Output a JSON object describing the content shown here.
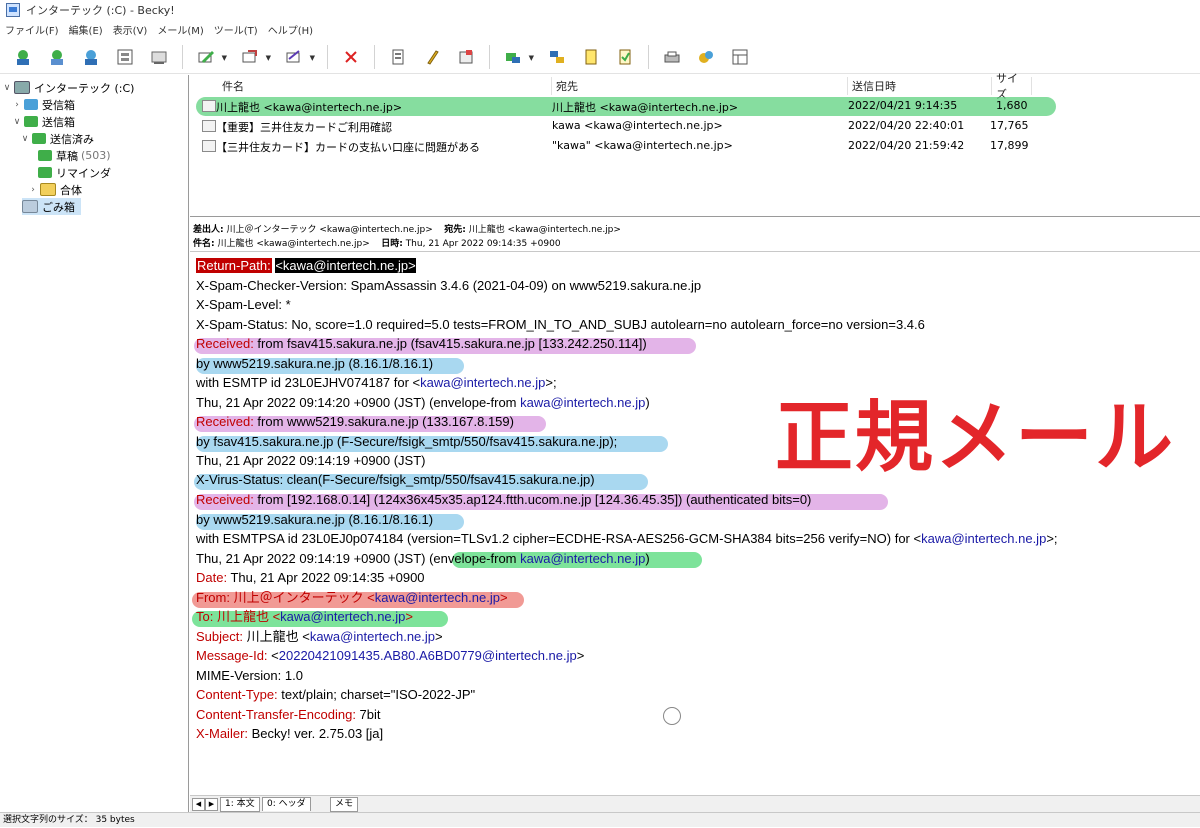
{
  "window": {
    "title": "インターテック (:C) - Becky!"
  },
  "menu": [
    "ファイル(F)",
    "編集(E)",
    "表示(V)",
    "メール(M)",
    "ツール(T)",
    "ヘルプ(H)"
  ],
  "toolbar": {
    "icons": [
      "receive-icon",
      "receive-all-icon",
      "send-icon",
      "folder-sync-icon",
      "address-book-icon",
      "compose-icon",
      "reply-icon",
      "forward-icon",
      "delete-icon",
      "filter-icon",
      "edit-icon",
      "flag-icon",
      "move-icon",
      "copy-icon",
      "memo-icon",
      "note-icon",
      "print-icon",
      "setting-icon",
      "layout-icon"
    ]
  },
  "folders": [
    {
      "label": "インターテック (:C)",
      "count": ""
    },
    {
      "label": "受信箱",
      "count": ""
    },
    {
      "label": "送信箱",
      "count": ""
    },
    {
      "label": "送信済み",
      "count": ""
    },
    {
      "label": "草稿",
      "count": "(503)"
    },
    {
      "label": "リマインダ",
      "count": ""
    },
    {
      "label": "合体",
      "count": ""
    },
    {
      "label": "ごみ箱",
      "count": ""
    }
  ],
  "list": {
    "columns": [
      "件名",
      "宛先",
      "送信日時",
      "サイズ"
    ],
    "rows": [
      {
        "subject": "川上龍也 <kawa@intertech.ne.jp>",
        "to": "川上龍也 <kawa@intertech.ne.jp>",
        "date": "2022/04/21 9:14:35",
        "size": "1,680"
      },
      {
        "subject": "【重要】三井住友カードご利用確認",
        "to": "kawa <kawa@intertech.ne.jp>",
        "date": "2022/04/20 22:40:01",
        "size": "17,765"
      },
      {
        "subject": "【三井住友カード】カードの支払い口座に問題がある",
        "to": "\"kawa\" <kawa@intertech.ne.jp>",
        "date": "2022/04/20 21:59:42",
        "size": "17,899"
      }
    ]
  },
  "preview_header": {
    "from_label": "差出人:",
    "from_value": "川上＠インターテック <kawa@intertech.ne.jp>",
    "to_label": "宛先:",
    "to_value": "川上龍也 <kawa@intertech.ne.jp>",
    "subject_label": "件名:",
    "subject_value": "川上龍也 <kawa@intertech.ne.jp>",
    "date_label": "日時:",
    "date_value": "Thu, 21 Apr 2022 09:14:35 +0900"
  },
  "headers": {
    "return_path_label": "Return-Path:",
    "return_path_value": "<kawa@intertech.ne.jp>",
    "l2": "X-Spam-Checker-Version: SpamAssassin 3.4.6 (2021-04-09) on www5219.sakura.ne.jp",
    "l3": "X-Spam-Level: *",
    "l4": "X-Spam-Status: No, score=1.0 required=5.0 tests=FROM_IN_TO_AND_SUBJ autolearn=no autolearn_force=no version=3.4.6",
    "recv_label": "Received:",
    "r1a": " from fsav415.sakura.ne.jp (fsav415.sakura.ne.jp [133.242.250.114])",
    "r1b": " by www5219.sakura.ne.jp (8.16.1/8.16.1)",
    "r1c_pre": " with ESMTP id 23L0EJHV074187 for <",
    "r1c_link": "kawa@intertech.ne.jp",
    "r1c_post": ">;",
    "r1d_pre": " Thu, 21 Apr 2022 09:14:20 +0900 (JST) (envelope-from ",
    "r1d_link": "kawa@intertech.ne.jp",
    "r1d_post": ")",
    "r2a": " from www5219.sakura.ne.jp (133.167.8.159)",
    "r2b": " by fsav415.sakura.ne.jp (F-Secure/fsigk_smtp/550/fsav415.sakura.ne.jp);",
    "r2c": " Thu, 21 Apr 2022 09:14:19 +0900 (JST)",
    "virus": "X-Virus-Status: clean(F-Secure/fsigk_smtp/550/fsav415.sakura.ne.jp)",
    "r3a": " from [192.168.0.14] (124x36x45x35.ap124.ftth.ucom.ne.jp [124.36.45.35]) (authenticated bits=0)",
    "r3b": " by www5219.sakura.ne.jp (8.16.1/8.16.1)",
    "r3c_pre": " with ESMTPSA id 23L0EJ0p074184 (version=TLSv1.2 cipher=ECDHE-RSA-AES256-GCM-SHA384 bits=256 verify=NO) for <",
    "r3c_link": "kawa@intertech.ne.jp",
    "r3c_post": ">;",
    "r3d_pre": " Thu, 21 Apr 2022 09:14:19 +0900 (JST) ",
    "r3d_env": "(envelope-from ",
    "r3d_link": "kawa@intertech.ne.jp",
    "r3d_post": ")",
    "date_label": "Date:",
    "date_value": " Thu, 21 Apr 2022 09:14:35 +0900",
    "from_label": "From:",
    "from_name": " 川上＠インターテック <",
    "from_link": "kawa@intertech.ne.jp",
    "from_post": ">",
    "to_label": "To:",
    "to_name": " 川上龍也 <",
    "to_link": "kawa@intertech.ne.jp",
    "to_post": ">",
    "subj_label": "Subject:",
    "subj_name": " 川上龍也 <",
    "subj_link": "kawa@intertech.ne.jp",
    "subj_post": ">",
    "msgid_label": "Message-Id:",
    "msgid_pre": " <",
    "msgid_link": "20220421091435.AB80.A6BD0779@intertech.ne.jp",
    "msgid_post": ">",
    "mime": "MIME-Version: 1.0",
    "ctype_label": "Content-Type:",
    "ctype_value": " text/plain; charset=\"ISO-2022-JP\"",
    "cte_label": "Content-Transfer-Encoding:",
    "cte_value": " 7bit",
    "mailer_label": "X-Mailer:",
    "mailer_value": " Becky! ver. 2.75.03 [ja]"
  },
  "annotation": "正規メール",
  "tabs": [
    "1: 本文",
    "0: ヘッダ",
    "メモ"
  ],
  "status": "選択文字列のサイズ： 35 bytes"
}
